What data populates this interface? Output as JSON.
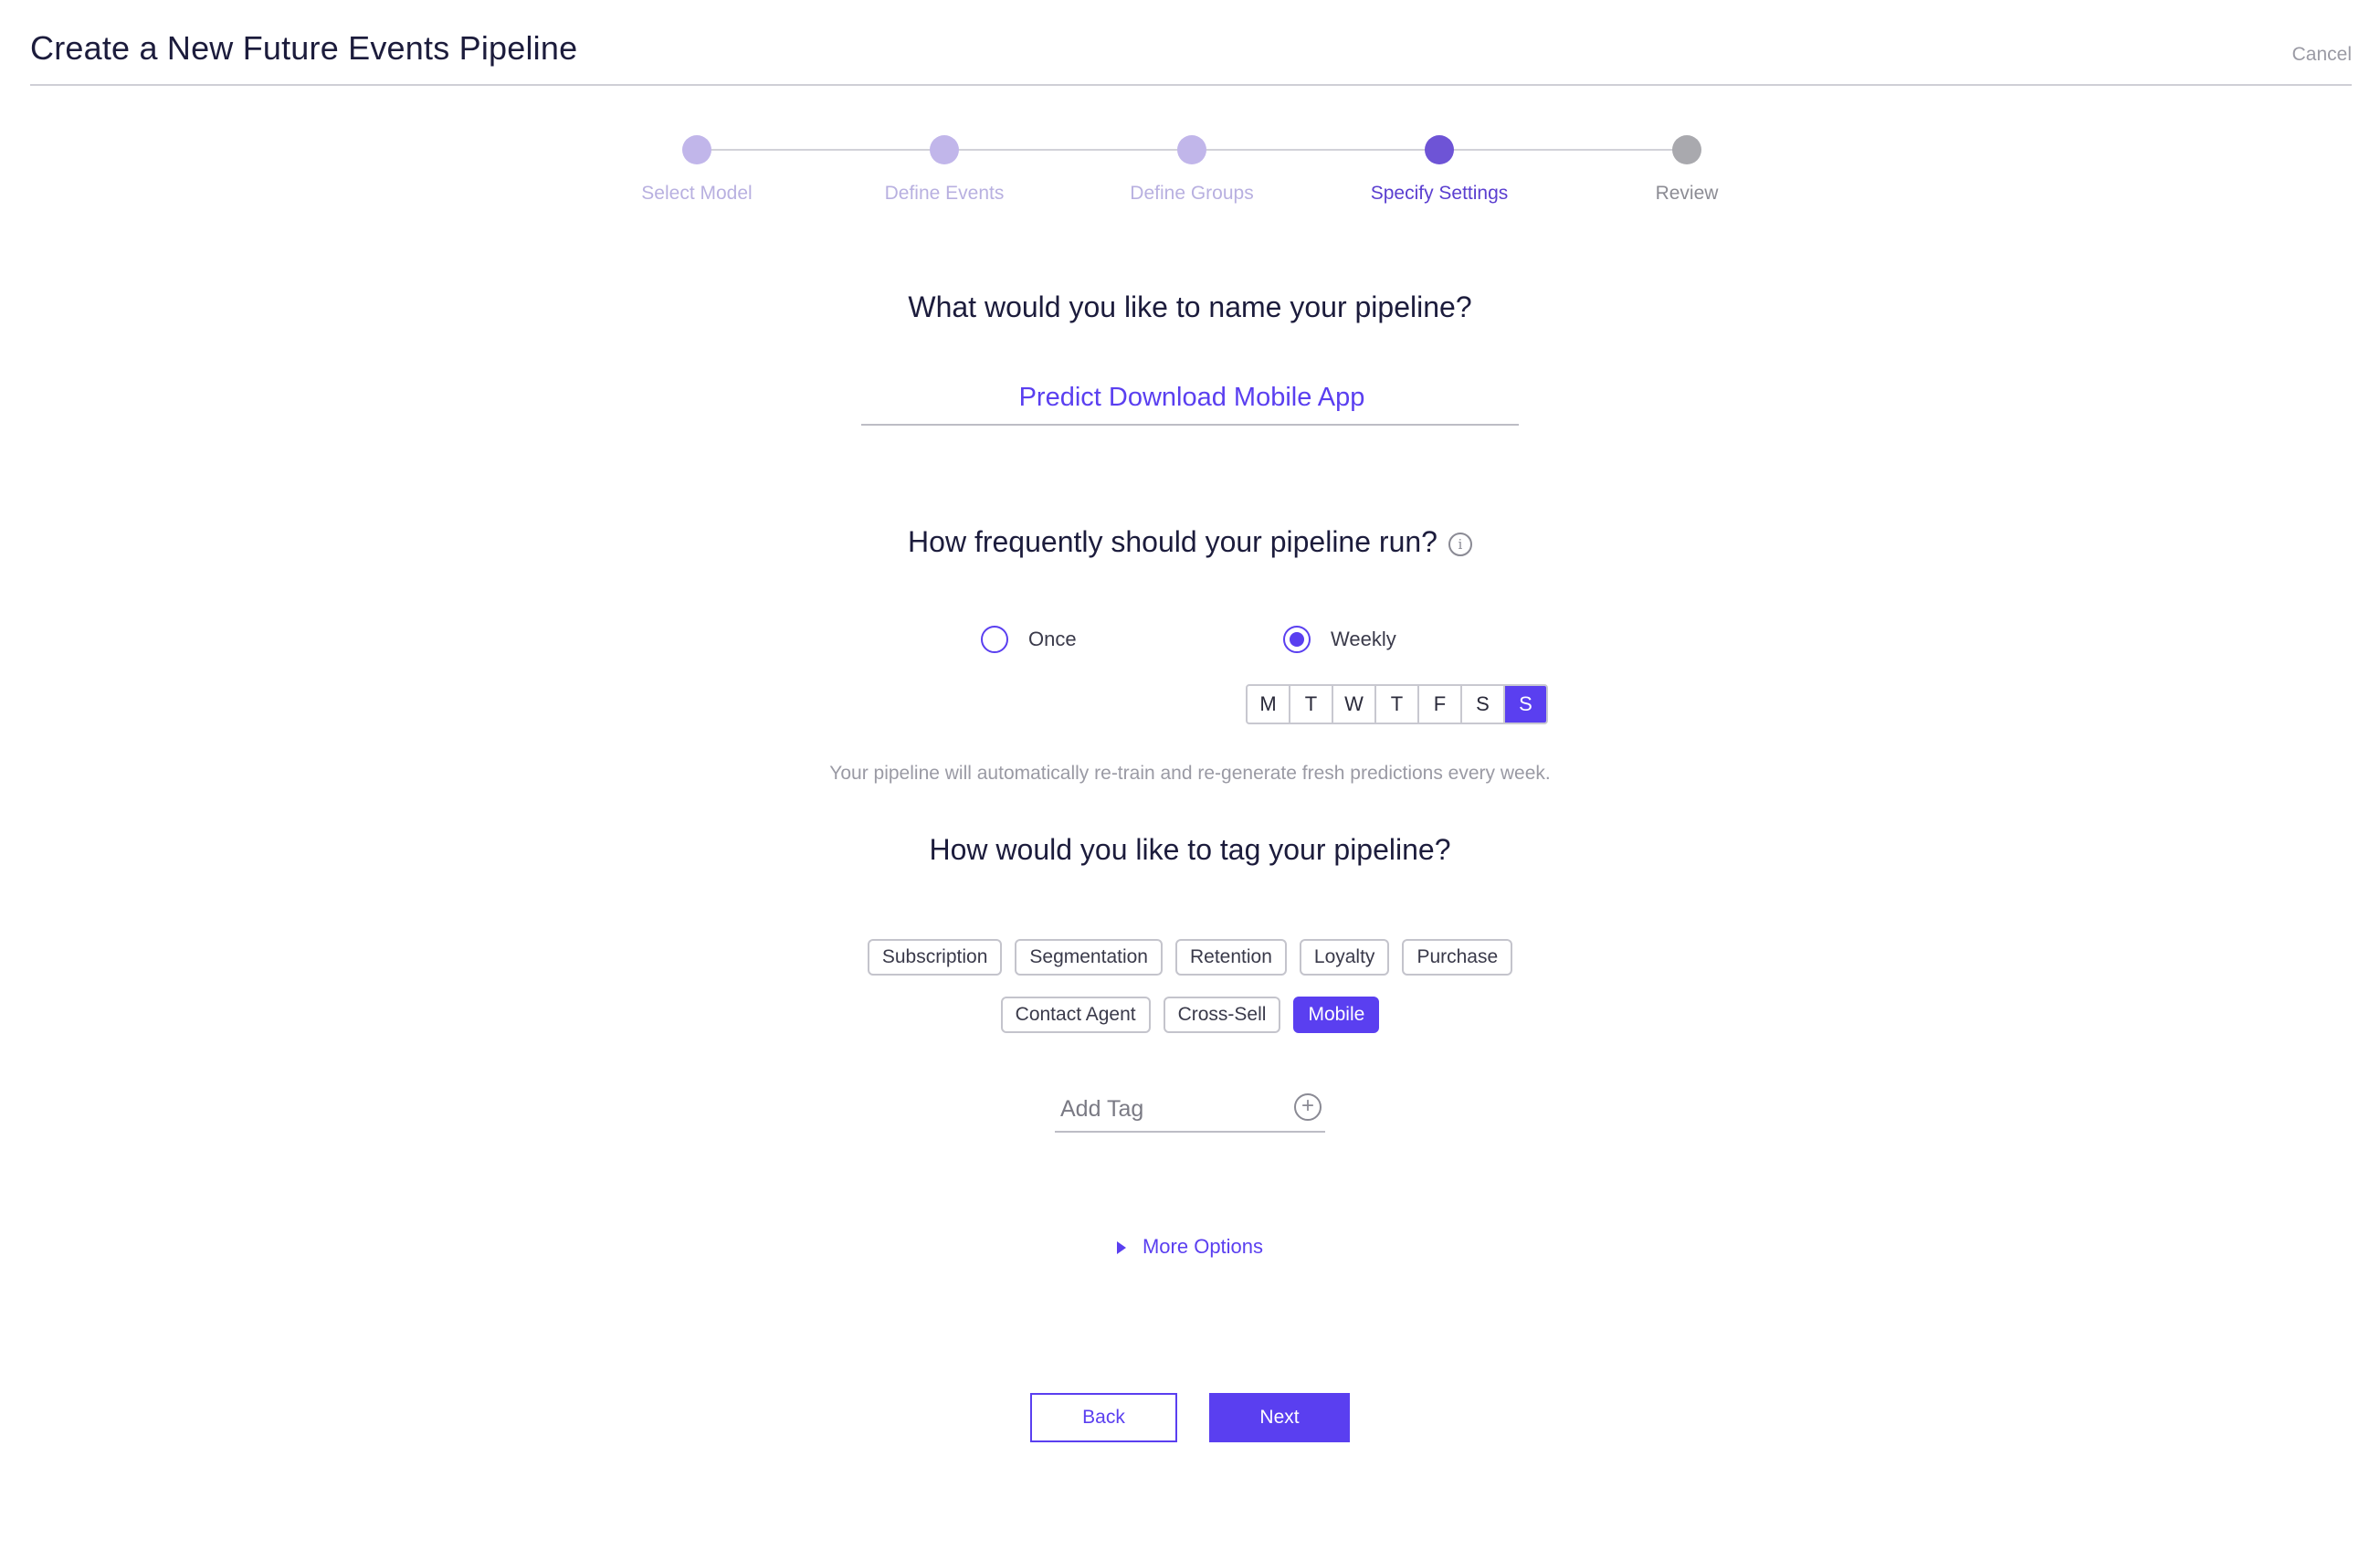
{
  "header": {
    "title": "Create a New Future Events Pipeline",
    "cancel_label": "Cancel"
  },
  "stepper": {
    "steps": [
      {
        "label": "Select Model",
        "state": "done"
      },
      {
        "label": "Define Events",
        "state": "done"
      },
      {
        "label": "Define Groups",
        "state": "done"
      },
      {
        "label": "Specify Settings",
        "state": "active"
      },
      {
        "label": "Review",
        "state": "todo"
      }
    ]
  },
  "name_section": {
    "question": "What would you like to name your pipeline?",
    "value": "Predict Download Mobile App"
  },
  "frequency_section": {
    "question": "How frequently should your pipeline run?",
    "info_icon": "info-icon",
    "options": [
      {
        "label": "Once",
        "checked": false
      },
      {
        "label": "Weekly",
        "checked": true
      }
    ],
    "days": [
      {
        "label": "M",
        "selected": false
      },
      {
        "label": "T",
        "selected": false
      },
      {
        "label": "W",
        "selected": false
      },
      {
        "label": "T",
        "selected": false
      },
      {
        "label": "F",
        "selected": false
      },
      {
        "label": "S",
        "selected": false
      },
      {
        "label": "S",
        "selected": true
      }
    ],
    "helper": "Your pipeline will automatically re-train and re-generate fresh predictions every week."
  },
  "tag_section": {
    "question": "How would you like to tag your pipeline?",
    "row1": [
      {
        "label": "Subscription",
        "selected": false
      },
      {
        "label": "Segmentation",
        "selected": false
      },
      {
        "label": "Retention",
        "selected": false
      },
      {
        "label": "Loyalty",
        "selected": false
      },
      {
        "label": "Purchase",
        "selected": false
      }
    ],
    "row2": [
      {
        "label": "Contact Agent",
        "selected": false
      },
      {
        "label": "Cross-Sell",
        "selected": false
      },
      {
        "label": "Mobile",
        "selected": true
      }
    ],
    "add_tag_placeholder": "Add Tag",
    "add_icon": "plus-circle-icon"
  },
  "more_options": {
    "label": "More Options",
    "icon": "caret-right-icon"
  },
  "footer": {
    "back_label": "Back",
    "next_label": "Next"
  },
  "colors": {
    "accent": "#5a3ff0",
    "step_done": "#c1b6ea",
    "step_active": "#6e54d6",
    "step_todo": "#a9a9ae"
  }
}
